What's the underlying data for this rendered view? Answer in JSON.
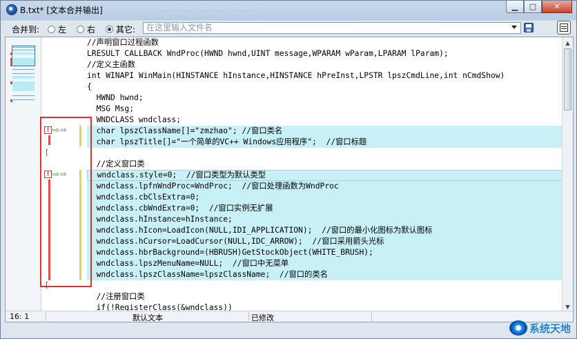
{
  "window": {
    "title": "B.txt*  [文本合并输出]",
    "ghost_title": "...........  ..........  ..........",
    "buttons": {
      "minimize": "▁",
      "maximize": "□",
      "close": "✕"
    }
  },
  "merge_bar": {
    "label": "合并到:",
    "options": [
      {
        "label": "左",
        "selected": false
      },
      {
        "label": "右",
        "selected": false
      },
      {
        "label": "其它:",
        "selected": true
      }
    ],
    "filename_placeholder": "在这里输入文件名"
  },
  "code_lines": [
    {
      "text": "//声明窗口过程函数",
      "indent": 0,
      "hl": false
    },
    {
      "text": "LRESULT CALLBACK WndProc(HWND hwnd,UINT message,WPARAM wParam,LPARAM lParam);",
      "indent": 0,
      "hl": false
    },
    {
      "text": "//定义主函数",
      "indent": 0,
      "hl": false
    },
    {
      "text": "int WINAPI WinMain(HINSTANCE hInstance,HINSTANCE hPreInst,LPSTR lpszCmdLine,int nCmdShow)",
      "indent": 0,
      "hl": false
    },
    {
      "text": "{",
      "indent": 0,
      "hl": false
    },
    {
      "text": "  HWND hwnd;",
      "indent": 0,
      "hl": false
    },
    {
      "text": "  MSG Msg;",
      "indent": 0,
      "hl": false
    },
    {
      "text": "  WNDCLASS wndclass;",
      "indent": 0,
      "hl": false
    },
    {
      "text": "  char lpszClassName[]=\"zmzhao\"; //窗口类名",
      "indent": 0,
      "hl": true
    },
    {
      "text": "  char lpszTitle[]=\"一个简单的VC++ Windows应用程序\";  //窗口标题",
      "indent": 0,
      "hl": true
    },
    {
      "text": "",
      "indent": 0,
      "hl": false
    },
    {
      "text": "  //定义窗口类",
      "indent": 0,
      "hl": false
    },
    {
      "text": "  wndclass.style=0;  //窗口类型为默认类型",
      "indent": 0,
      "hl": true,
      "cur": true
    },
    {
      "text": "  wndclass.lpfnWndProc=WndProc;  //窗口处理函数为WndProc",
      "indent": 0,
      "hl": true
    },
    {
      "text": "  wndclass.cbClsExtra=0;",
      "indent": 0,
      "hl": true
    },
    {
      "text": "  wndclass.cbWndExtra=0;  //窗口实例无扩展",
      "indent": 0,
      "hl": true
    },
    {
      "text": "  wndclass.hInstance=hInstance;",
      "indent": 0,
      "hl": true
    },
    {
      "text": "  wndclass.hIcon=LoadIcon(NULL,IDI_APPLICATION);  //窗口的最小化图标为默认图标",
      "indent": 0,
      "hl": true
    },
    {
      "text": "  wndclass.hCursor=LoadCursor(NULL,IDC_ARROW);  //窗口采用箭头光标",
      "indent": 0,
      "hl": true
    },
    {
      "text": "  wndclass.hbrBackground=(HBRUSH)GetStockObject(WHITE_BRUSH);",
      "indent": 0,
      "hl": true
    },
    {
      "text": "  wndclass.lpszMenuName=NULL;  //窗口中无菜单",
      "indent": 0,
      "hl": true
    },
    {
      "text": "  wndclass.lpszClassName=lpszClassName;  //窗口的类名",
      "indent": 0,
      "hl": true
    },
    {
      "text": "",
      "indent": 0,
      "hl": false
    },
    {
      "text": "  //注册窗口类",
      "indent": 0,
      "hl": false
    },
    {
      "text": "  if(!RegisterClass(&wndclass))",
      "indent": 0,
      "hl": false
    }
  ],
  "gutter": {
    "warn_glyph": "!",
    "arrow_right": "⇨",
    "arrow_left": "⇨",
    "bracket": "["
  },
  "status": {
    "position": "16: 1",
    "encoding_label": "默认文本",
    "modified_label": "已修改"
  },
  "watermark": {
    "text": "系统天地"
  },
  "colors": {
    "highlight": "#c8f1f7",
    "diff_red": "#e64a4a",
    "diff_yellow": "#f0d24a",
    "annotation": "#e23030"
  }
}
